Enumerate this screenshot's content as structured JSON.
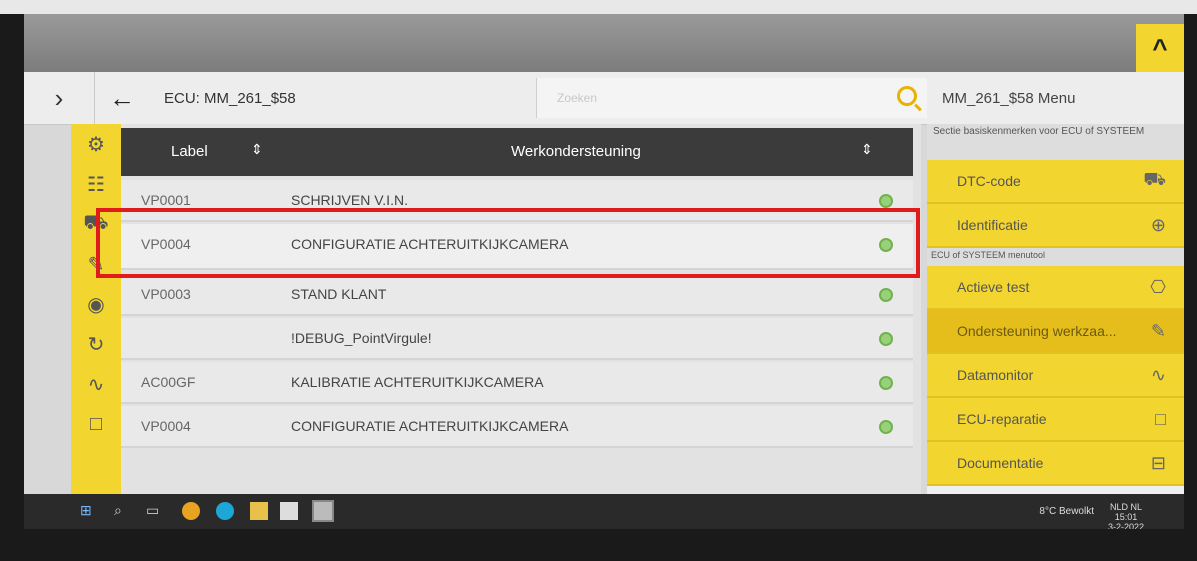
{
  "header": {
    "ecu_label": "ECU: MM_261_$58",
    "search_placeholder": "Zoeken",
    "menu_title": "MM_261_$58 Menu"
  },
  "table": {
    "col_label": "Label",
    "col_task": "Werkondersteuning",
    "rows": [
      {
        "code": "VP0001",
        "name": "SCHRIJVEN V.I.N."
      },
      {
        "code": "VP0004",
        "name": "CONFIGURATIE ACHTERUITKIJKCAMERA"
      },
      {
        "code": "VP0003",
        "name": "STAND KLANT"
      },
      {
        "code": "",
        "name": "!DEBUG_PointVirgule!"
      },
      {
        "code": "AC00GF",
        "name": "KALIBRATIE ACHTERUITKIJKCAMERA"
      },
      {
        "code": "VP0004",
        "name": "CONFIGURATIE ACHTERUITKIJKCAMERA"
      }
    ]
  },
  "right_menu": {
    "section1": "Sectie basiskenmerken voor ECU of SYSTEEM",
    "section2": "ECU of SYSTEEM menutool",
    "items": [
      "DTC-code",
      "Identificatie",
      "Actieve test",
      "Ondersteuning werkzaa...",
      "Datamonitor",
      "ECU-reparatie",
      "Documentatie"
    ]
  },
  "taskbar": {
    "weather": "8°C Bewolkt",
    "lang": "NLD NL",
    "time": "15:01",
    "date": "3-2-2022"
  },
  "colors": {
    "accent": "#f2d52e",
    "highlight": "#e01b1b"
  }
}
